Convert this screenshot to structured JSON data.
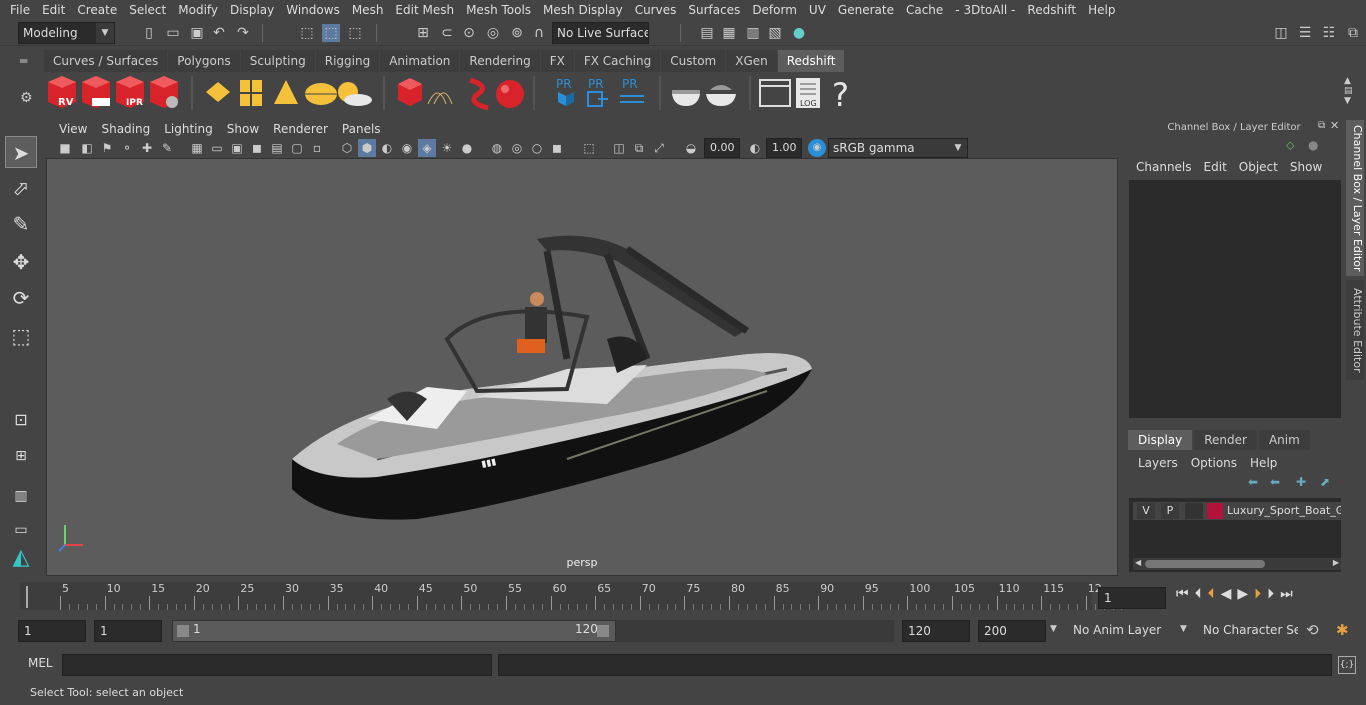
{
  "menus": [
    "File",
    "Edit",
    "Create",
    "Select",
    "Modify",
    "Display",
    "Windows",
    "Mesh",
    "Edit Mesh",
    "Mesh Tools",
    "Mesh Display",
    "Curves",
    "Surfaces",
    "Deform",
    "UV",
    "Generate",
    "Cache",
    "- 3DtoAll -",
    "Redshift",
    "Help"
  ],
  "status": {
    "mode": "Modeling",
    "live_surface": "No Live Surface"
  },
  "shelf_tabs": [
    "Curves / Surfaces",
    "Polygons",
    "Sculpting",
    "Rigging",
    "Animation",
    "Rendering",
    "FX",
    "FX Caching",
    "Custom",
    "XGen",
    "Redshift"
  ],
  "active_shelf": "Redshift",
  "shelf_icons": {
    "rv": "RV",
    "ipr": "IPR",
    "pr1": "PR",
    "pr2": "PR",
    "pr3": "PR",
    "log": "LOG",
    "help": "?"
  },
  "viewport": {
    "menus": [
      "View",
      "Shading",
      "Lighting",
      "Show",
      "Renderer",
      "Panels"
    ],
    "exposure": "0.00",
    "gamma": "1.00",
    "color_space": "sRGB gamma",
    "camera": "persp"
  },
  "channel_box": {
    "title": "Channel Box / Layer Editor",
    "menus": [
      "Channels",
      "Edit",
      "Object",
      "Show"
    ]
  },
  "layer_editor": {
    "tabs": [
      "Display",
      "Render",
      "Anim"
    ],
    "active_tab": "Display",
    "menus": [
      "Layers",
      "Options",
      "Help"
    ],
    "layer": {
      "v": "V",
      "p": "P",
      "name": "Luxury_Sport_Boat_Ge",
      "color": "#b3123a"
    }
  },
  "side_tabs": [
    "Channel Box / Layer Editor",
    "Attribute Editor"
  ],
  "timeline": {
    "ticks": [
      "5",
      "10",
      "15",
      "20",
      "25",
      "30",
      "35",
      "40",
      "45",
      "50",
      "55",
      "60",
      "65",
      "70",
      "75",
      "80",
      "85",
      "90",
      "95",
      "100",
      "105",
      "110",
      "115",
      "12"
    ],
    "start_label": "1",
    "current_frame": "1"
  },
  "range": {
    "start": "1",
    "playback_start": "1",
    "slider_start": "1",
    "slider_end": "120",
    "playback_end": "120",
    "end": "200",
    "anim_layer": "No Anim Layer",
    "character_set": "No Character Set"
  },
  "mel": {
    "label": "MEL"
  },
  "help_line": "Select Tool: select an object",
  "colors": {
    "accent": "#5d5d5d",
    "redshift_red": "#d8232a",
    "maya_yellow": "#f5c13b",
    "pr_blue": "#2a8fd8"
  }
}
